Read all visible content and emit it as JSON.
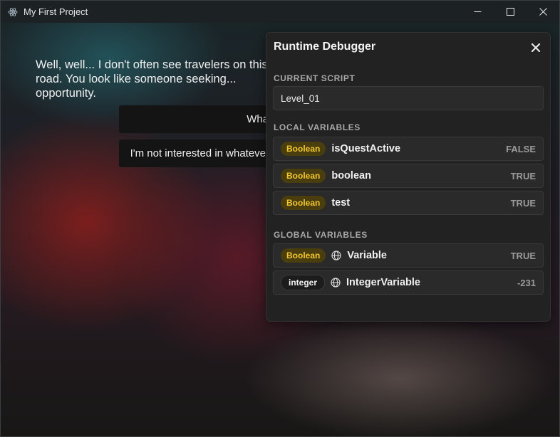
{
  "window": {
    "title": "My First Project",
    "icon": "electron-icon",
    "controls": [
      "minimize-icon",
      "maximize-icon",
      "close-icon"
    ]
  },
  "scene": {
    "dialogue": "Well, well... I don't often see travelers on this road. You look like someone seeking... opportunity.",
    "choices": [
      {
        "label": "What are you offering?"
      },
      {
        "label": "I'm not interested in whatever you're selling."
      }
    ]
  },
  "debugger": {
    "title": "Runtime Debugger",
    "current_script_label": "CURRENT SCRIPT",
    "current_script": "Level_01",
    "local_label": "LOCAL VARIABLES",
    "local_vars": [
      {
        "type": "Boolean",
        "name": "isQuestActive",
        "value": "FALSE"
      },
      {
        "type": "Boolean",
        "name": "boolean",
        "value": "TRUE"
      },
      {
        "type": "Boolean",
        "name": "test",
        "value": "TRUE"
      }
    ],
    "global_label": "GLOBAL VARIABLES",
    "global_vars": [
      {
        "type": "Boolean",
        "name": "Variable",
        "value": "TRUE",
        "icon": "globe-icon"
      },
      {
        "type": "integer",
        "name": "IntegerVariable",
        "value": "-231",
        "icon": "globe-icon"
      }
    ]
  },
  "colors": {
    "boolean_badge_text": "#f2c62f",
    "boolean_badge_bg": "#4a3e0f",
    "panel_bg": "#222222"
  }
}
